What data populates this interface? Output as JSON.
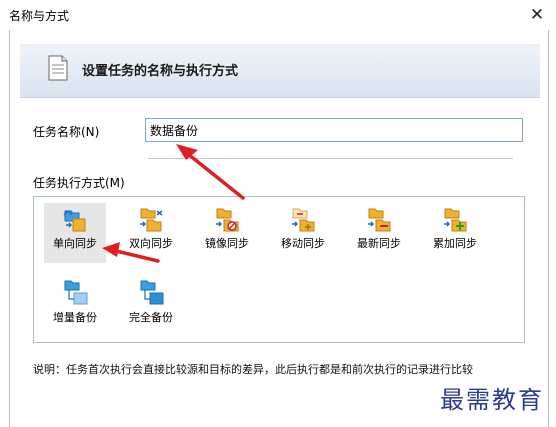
{
  "window": {
    "title": "名称与方式",
    "close_icon": "close-icon"
  },
  "header": {
    "title": "设置任务的名称与执行方式"
  },
  "name_field": {
    "label": "任务名称(N)",
    "value": "数据备份"
  },
  "mode_group": {
    "label": "任务执行方式(M)",
    "items": [
      {
        "label": "单向同步",
        "icon": "one-way-sync-icon",
        "selected": true
      },
      {
        "label": "双向同步",
        "icon": "two-way-sync-icon",
        "selected": false
      },
      {
        "label": "镜像同步",
        "icon": "mirror-sync-icon",
        "selected": false
      },
      {
        "label": "移动同步",
        "icon": "move-sync-icon",
        "selected": false
      },
      {
        "label": "最新同步",
        "icon": "latest-sync-icon",
        "selected": false
      },
      {
        "label": "累加同步",
        "icon": "accumulate-sync-icon",
        "selected": false
      },
      {
        "label": "增量备份",
        "icon": "incremental-backup-icon",
        "selected": false
      },
      {
        "label": "完全备份",
        "icon": "full-backup-icon",
        "selected": false
      }
    ]
  },
  "note": "说明：任务首次执行会直接比较源和目标的差异，此后执行都是和前次执行的记录进行比较",
  "watermark": "最需教育",
  "colors": {
    "arrow": "#e02020",
    "accent_blue": "#2f8fd6",
    "folder_yellow": "#f0b030"
  }
}
